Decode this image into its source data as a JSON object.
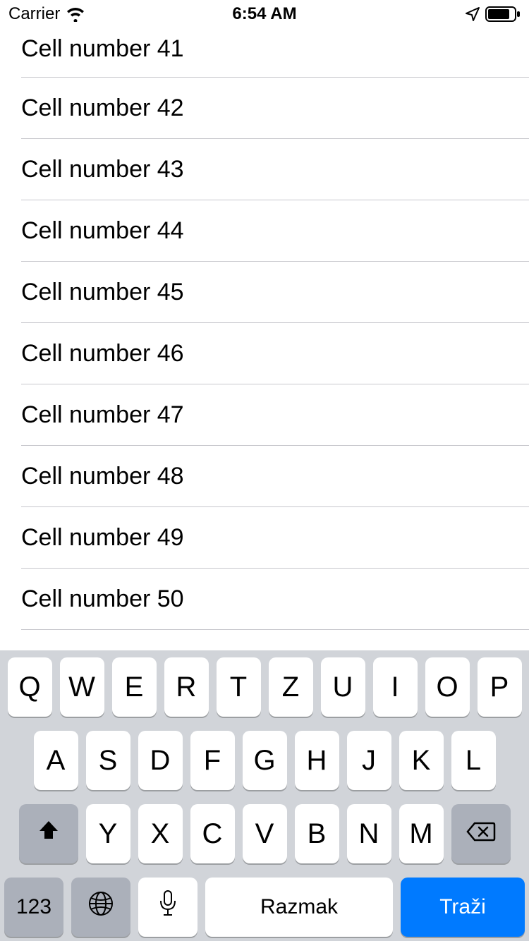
{
  "statusBar": {
    "carrier": "Carrier",
    "time": "6:54 AM"
  },
  "list": {
    "cells": [
      {
        "label": "Cell number 41"
      },
      {
        "label": "Cell number 42"
      },
      {
        "label": "Cell number 43"
      },
      {
        "label": "Cell number 44"
      },
      {
        "label": "Cell number 45"
      },
      {
        "label": "Cell number 46"
      },
      {
        "label": "Cell number 47"
      },
      {
        "label": "Cell number 48"
      },
      {
        "label": "Cell number 49"
      },
      {
        "label": "Cell number 50"
      }
    ]
  },
  "keyboard": {
    "row1": [
      "Q",
      "W",
      "E",
      "R",
      "T",
      "Z",
      "U",
      "I",
      "O",
      "P"
    ],
    "row2": [
      "A",
      "S",
      "D",
      "F",
      "G",
      "H",
      "J",
      "K",
      "L"
    ],
    "row3": [
      "Y",
      "X",
      "C",
      "V",
      "B",
      "N",
      "M"
    ],
    "numKey": "123",
    "spaceLabel": "Razmak",
    "returnLabel": "Traži"
  }
}
